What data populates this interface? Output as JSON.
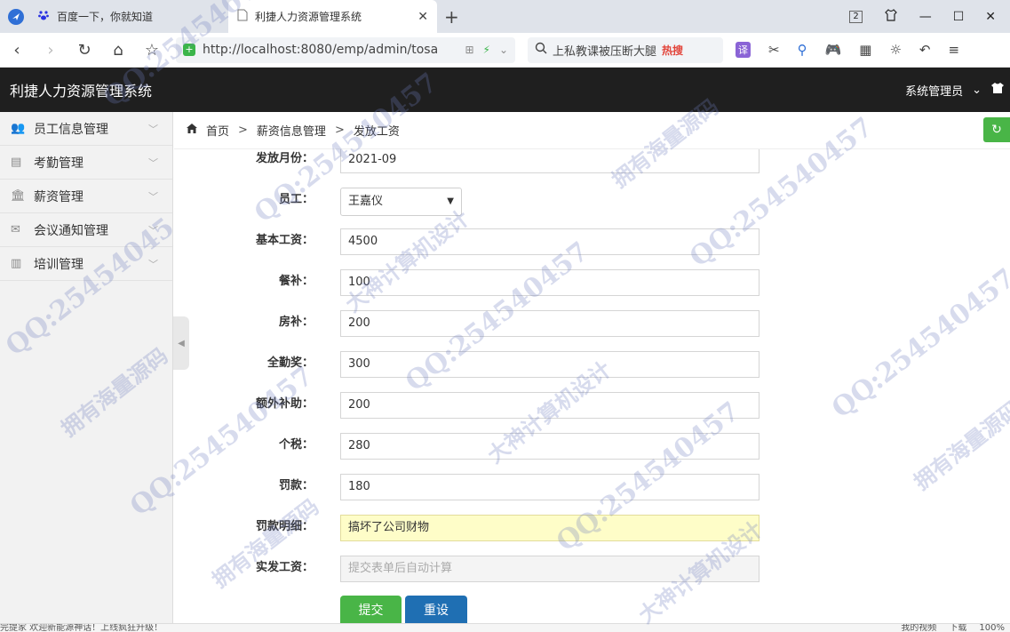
{
  "browser": {
    "tabs": [
      {
        "label": "百度一下，你就知道",
        "icon": "paw-icon"
      },
      {
        "label": "利捷人力资源管理系统",
        "icon": "page-icon"
      }
    ],
    "tab_count_badge": "2",
    "url": "http://localhost:8080/emp/admin/tosa",
    "search_text": "上私教课被压断大腿",
    "hot_label": "热搜",
    "translate_label": "译"
  },
  "app": {
    "title": "利捷人力资源管理系统",
    "user": "系统管理员"
  },
  "sidebar": {
    "items": [
      {
        "label": "员工信息管理",
        "icon": "users-icon"
      },
      {
        "label": "考勤管理",
        "icon": "clipboard-icon"
      },
      {
        "label": "薪资管理",
        "icon": "bank-icon"
      },
      {
        "label": "会议通知管理",
        "icon": "envelope-icon"
      },
      {
        "label": "培训管理",
        "icon": "book-icon"
      }
    ]
  },
  "breadcrumb": {
    "home": "首页",
    "level1": "薪资信息管理",
    "level2": "发放工资",
    "sep": ">"
  },
  "form": {
    "month": {
      "label": "发放月份：",
      "value": "2021-09"
    },
    "employee": {
      "label": "员工：",
      "value": "王嘉仪"
    },
    "base_salary": {
      "label": "基本工资：",
      "value": "4500"
    },
    "meal": {
      "label": "餐补：",
      "value": "100"
    },
    "housing": {
      "label": "房补：",
      "value": "200"
    },
    "attendance_bonus": {
      "label": "全勤奖：",
      "value": "300"
    },
    "extra_subsidy": {
      "label": "额外补助：",
      "value": "200"
    },
    "tax": {
      "label": "个税：",
      "value": "280"
    },
    "fine": {
      "label": "罚款：",
      "value": "180"
    },
    "fine_detail": {
      "label": "罚款明细：",
      "value": "搞坏了公司财物"
    },
    "net_pay": {
      "label": "实发工资：",
      "placeholder": "提交表单后自动计算"
    },
    "submit_label": "提交",
    "reset_label": "重设"
  },
  "statusbar": {
    "left": "完提家 欢迎新能源神话！上线疯狂升级！",
    "video": "我的视频",
    "download": "下载",
    "zoom": "100%"
  },
  "watermarks": {
    "qq": "QQ:25454045",
    "qq_full": "QQ:254540457",
    "design": "大神计算机设计",
    "source": "拥有海量源码"
  }
}
